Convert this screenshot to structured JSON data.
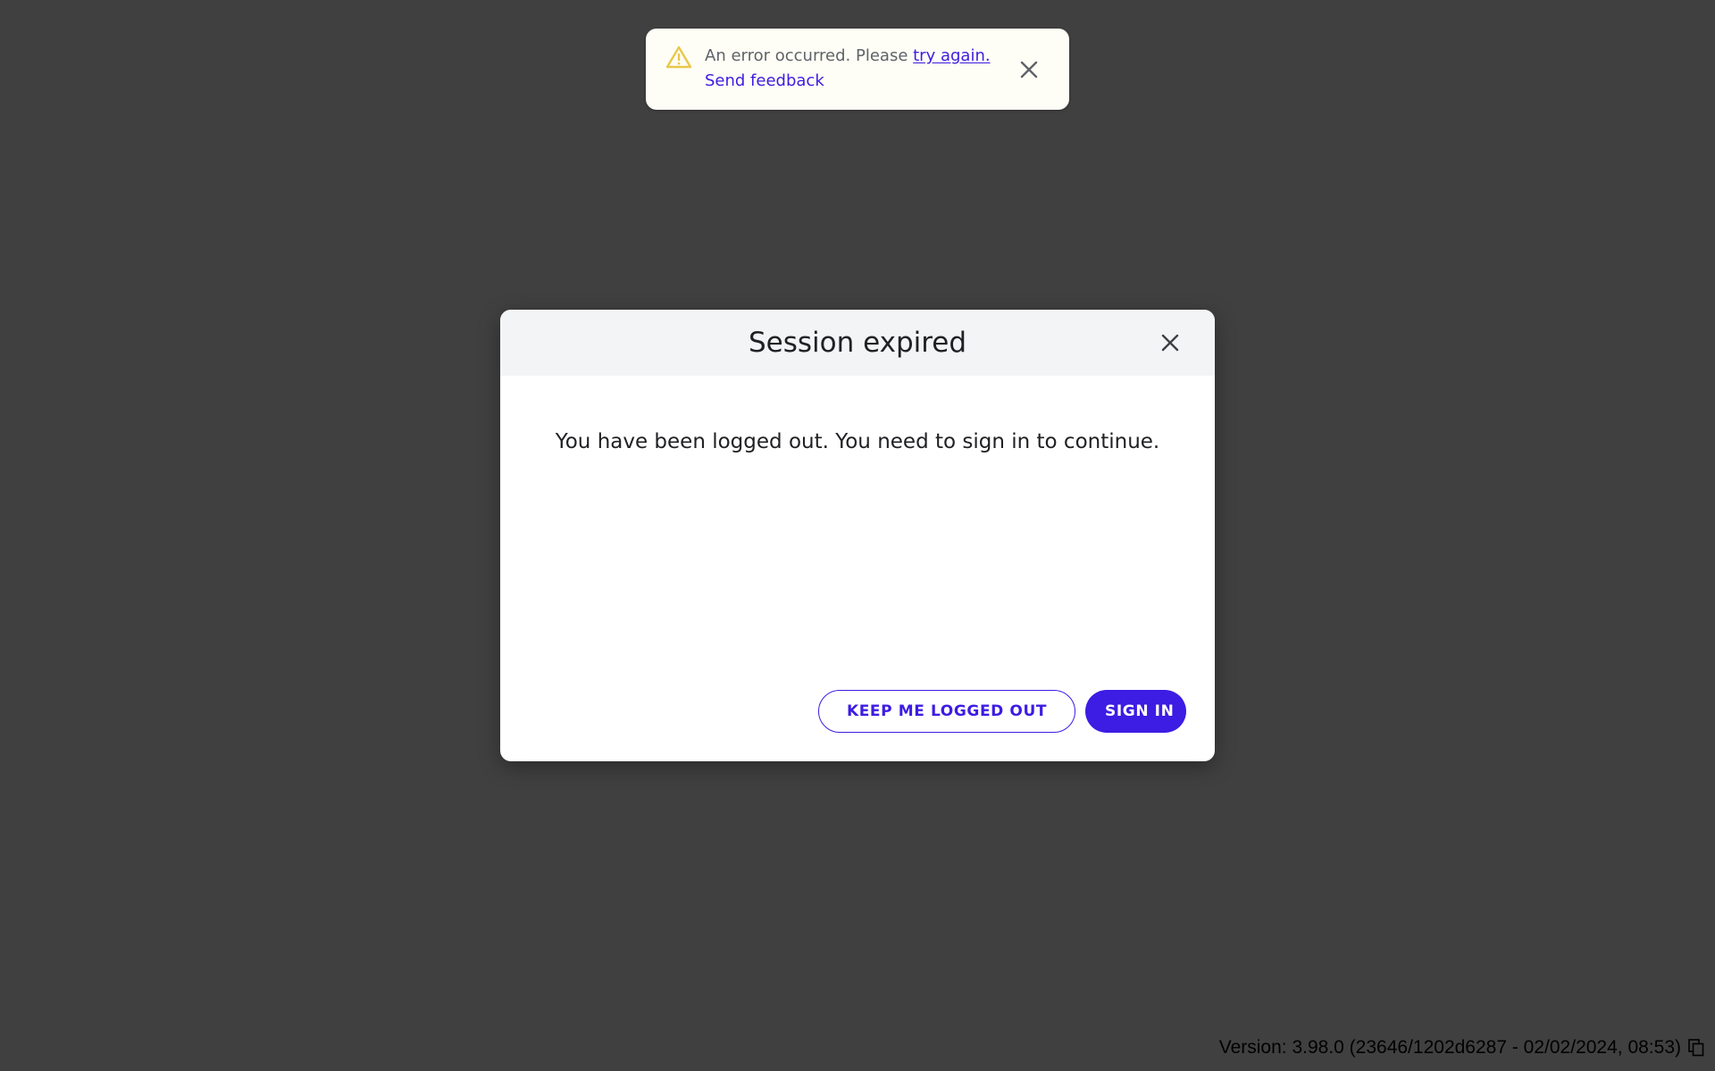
{
  "toast": {
    "message_prefix": "An error occurred. Please ",
    "retry_link": "try again.",
    "feedback_link": "Send feedback",
    "icon": "warning-icon",
    "close_icon": "close-icon"
  },
  "dialog": {
    "title": "Session expired",
    "message": "You have been logged out. You need to sign in to continue.",
    "close_icon": "close-icon",
    "secondary_button": "KEEP ME LOGGED OUT",
    "primary_button": "SIGN IN"
  },
  "footer": {
    "version_text": "Version: 3.98.0 (23646/1202d6287 - 02/02/2024, 08:53)",
    "copy_icon": "copy-icon"
  },
  "colors": {
    "backdrop": "#404040",
    "accent": "#3d1ce3",
    "warning": "#e8c84a",
    "toast_bg": "#fefdf6",
    "dialog_header_bg": "#f3f4f5"
  }
}
